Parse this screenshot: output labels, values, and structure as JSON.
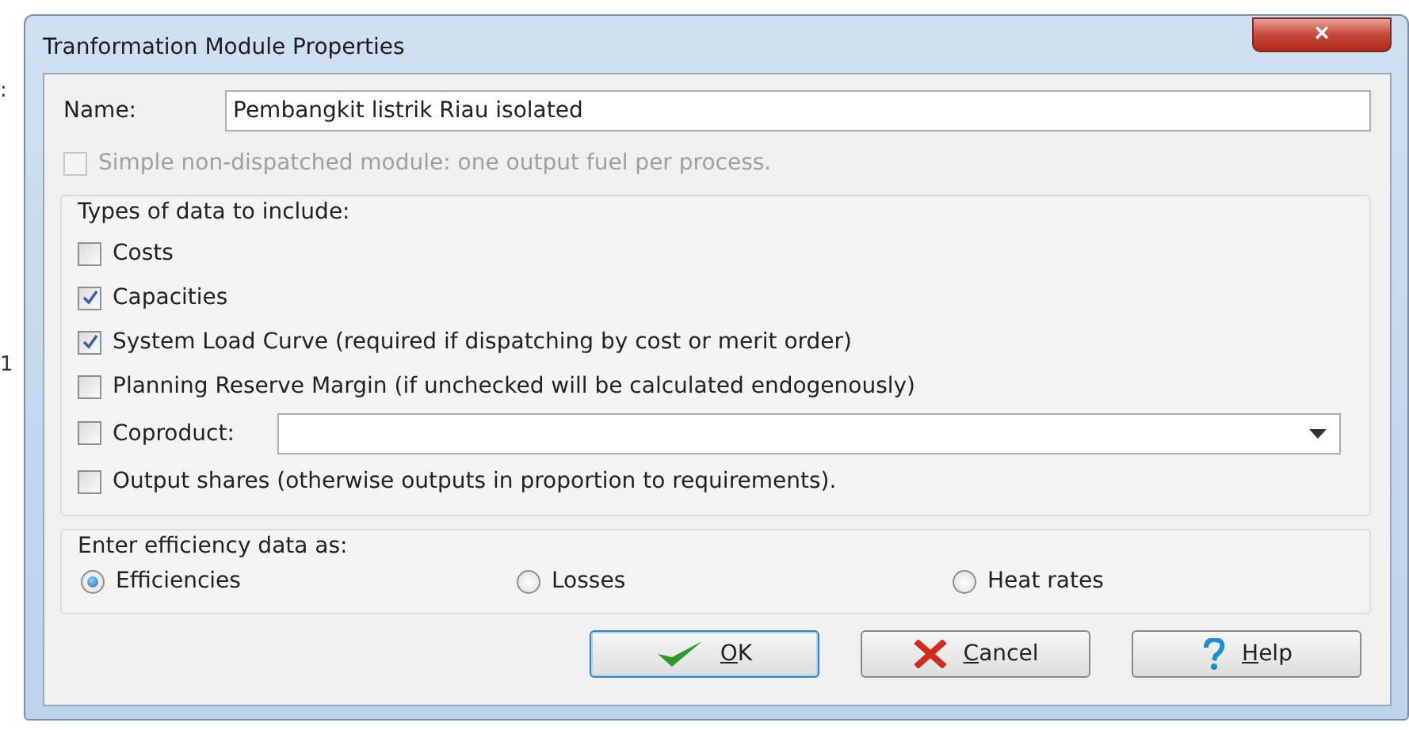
{
  "background_marks": [
    ":",
    "1"
  ],
  "window": {
    "title": "Tranformation Module Properties",
    "close": "×"
  },
  "name_field": {
    "label": "Name:",
    "value": "Pembangkit listrik Riau isolated"
  },
  "simple_option": {
    "label": "Simple non-dispatched module: one output fuel per process.",
    "checked": false,
    "disabled": true
  },
  "data_types": {
    "legend": "Types of data to include:",
    "items": [
      {
        "kind": "checkbox",
        "label": "Costs",
        "checked": false
      },
      {
        "kind": "checkbox",
        "label": "Capacities",
        "checked": true
      },
      {
        "kind": "checkbox",
        "label": "System Load Curve (required if dispatching by cost or merit order)",
        "checked": true
      },
      {
        "kind": "checkbox",
        "label": "Planning Reserve Margin (if unchecked will be calculated endogenously)",
        "checked": false
      },
      {
        "kind": "combo",
        "label": "Coproduct:",
        "checked": false
      },
      {
        "kind": "checkbox",
        "label": "Output shares (otherwise outputs in proportion to requirements).",
        "checked": false
      }
    ]
  },
  "efficiency": {
    "legend": "Enter efficiency data as:",
    "options": [
      {
        "label": "Efficiencies",
        "selected": true
      },
      {
        "label": "Losses",
        "selected": false
      },
      {
        "label": "Heat rates",
        "selected": false
      }
    ]
  },
  "buttons": [
    {
      "kind": "ok",
      "label": "OK",
      "mnemonic": true
    },
    {
      "kind": "cancel",
      "label": "Cancel",
      "mnemonic": true
    },
    {
      "kind": "help",
      "label": "Help",
      "mnemonic": true
    }
  ]
}
